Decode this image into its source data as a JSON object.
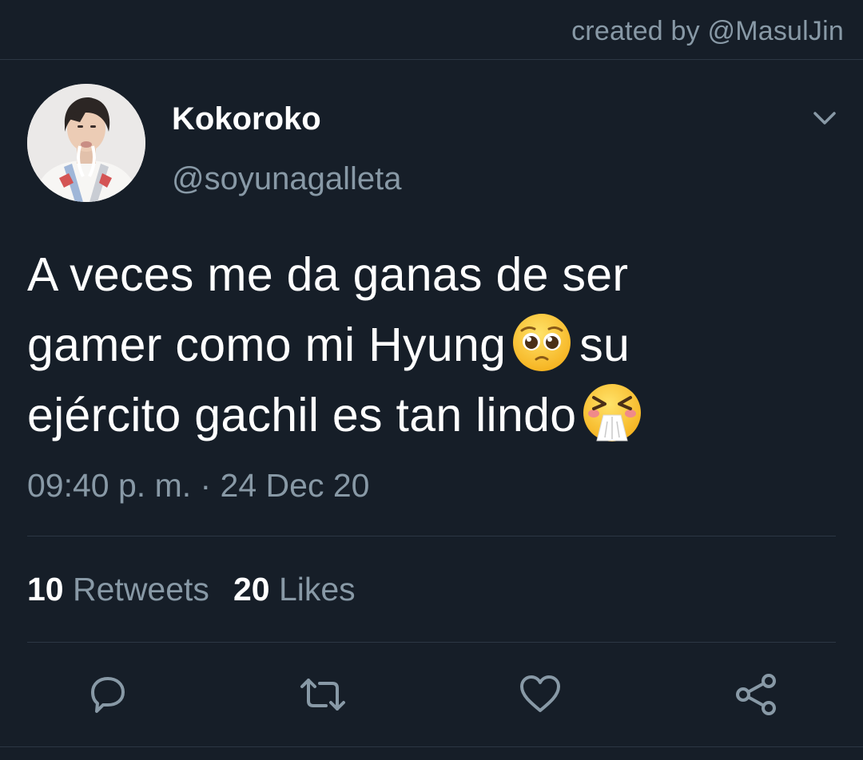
{
  "credit": "created by @MasulJin",
  "user": {
    "display_name": "Kokoroko",
    "handle": "@soyunagalleta"
  },
  "tweet": {
    "lines": [
      "A veces me da ganas de ser",
      "gamer como mi Hyung",
      "su",
      "ejército gachil es tan lindo"
    ],
    "emojis": [
      "pleading-face-emoji",
      "sneezing-face-emoji"
    ],
    "timestamp": "09:40 p. m. · 24 Dec 20"
  },
  "stats": {
    "retweets_count": "10",
    "retweets_label": "Retweets",
    "likes_count": "20",
    "likes_label": "Likes"
  },
  "actions": [
    "reply-icon",
    "retweet-icon",
    "like-icon",
    "share-icon"
  ],
  "colors": {
    "background": "#161e28",
    "secondary_text": "#8899a6",
    "divider": "#2c3744"
  }
}
